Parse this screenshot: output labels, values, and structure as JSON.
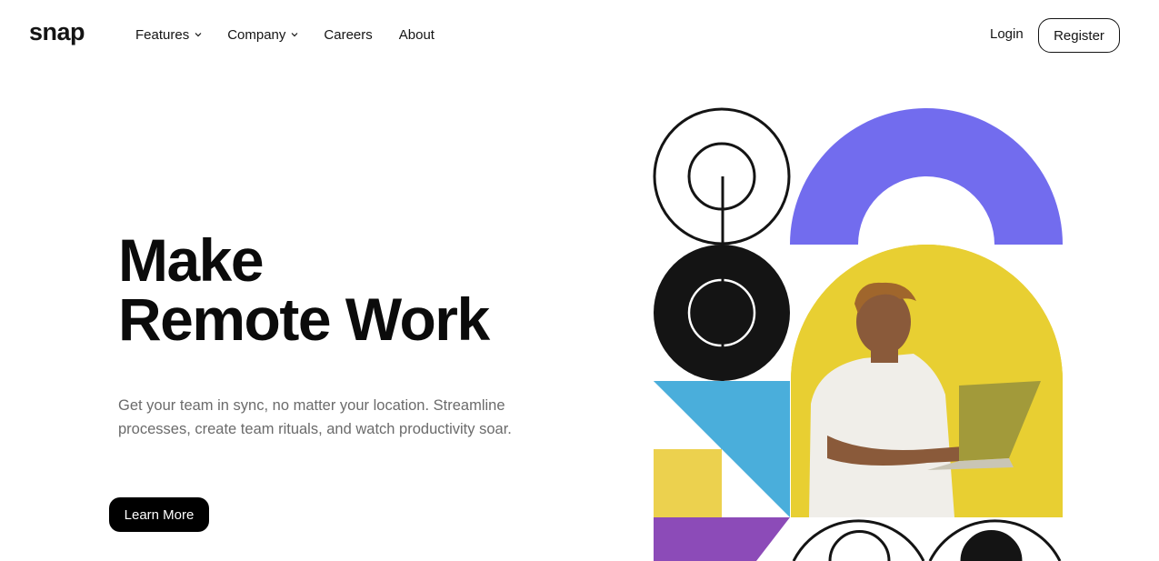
{
  "brand": {
    "logo": "snap"
  },
  "nav": {
    "items": [
      {
        "label": "Features",
        "has_dropdown": true
      },
      {
        "label": "Company",
        "has_dropdown": true
      },
      {
        "label": "Careers",
        "has_dropdown": false
      },
      {
        "label": "About",
        "has_dropdown": false
      }
    ]
  },
  "auth": {
    "login_label": "Login",
    "register_label": "Register"
  },
  "hero": {
    "title_line1": "Make",
    "title_line2": "Remote Work",
    "description": "Get your team in sync, no matter your location. Streamline processes, create team rituals, and watch productivity soar.",
    "cta_label": "Learn More"
  },
  "colors": {
    "text": "#141414",
    "muted": "#6b6b6b",
    "purple": "#726cee",
    "yellow": "#e8cf32",
    "blue": "#4aaedb",
    "violet": "#8c4bb8",
    "black": "#141414"
  },
  "icons": {
    "dropdown": "chevron-down-icon"
  }
}
